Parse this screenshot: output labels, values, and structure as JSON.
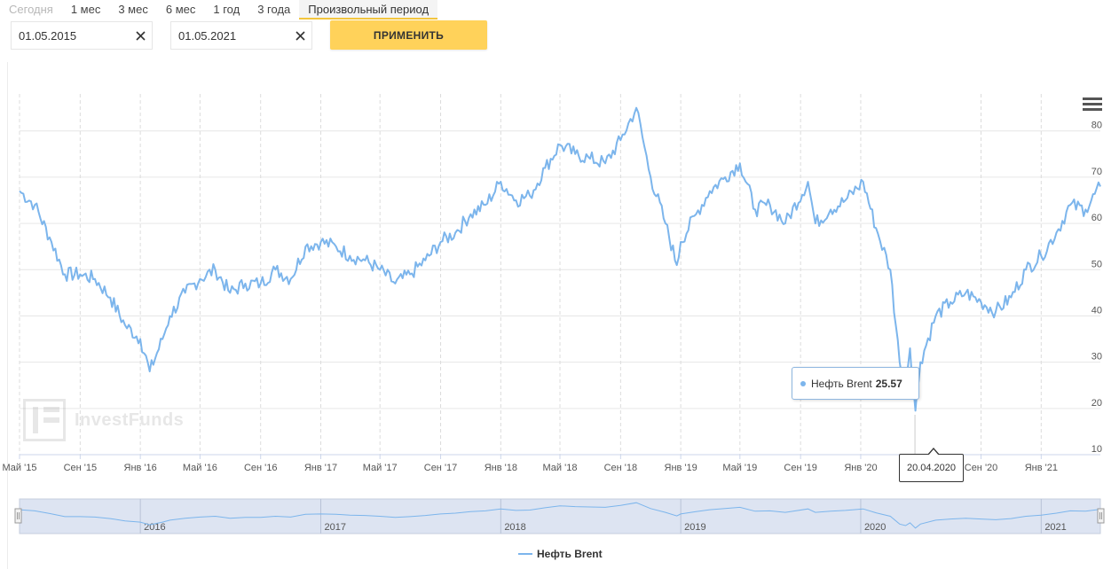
{
  "period_tabs": [
    {
      "label": "Сегодня",
      "state": "disabled"
    },
    {
      "label": "1 мес",
      "state": "normal"
    },
    {
      "label": "3 мес",
      "state": "normal"
    },
    {
      "label": "6 мес",
      "state": "normal"
    },
    {
      "label": "1 год",
      "state": "normal"
    },
    {
      "label": "3 года",
      "state": "normal"
    },
    {
      "label": "Произвольный период",
      "state": "active"
    }
  ],
  "date_from": "01.05.2015",
  "date_to": "01.05.2021",
  "apply_label": "ПРИМЕНИТЬ",
  "watermark": "InvestFunds",
  "tooltip": {
    "series": "Нефть Brent",
    "value": "25.57",
    "date": "20.04.2020"
  },
  "colors": {
    "line": "#7cb5ec",
    "apply": "#ffd25a",
    "navigator_fill": "#dde4f2"
  },
  "icons": {
    "menu": "hamburger-menu-icon",
    "clear": "close-icon"
  },
  "chart_data": {
    "type": "line",
    "series": [
      {
        "name": "Нефть Brent",
        "x": [
          "2015-05-01",
          "2015-06-01",
          "2015-07-01",
          "2015-08-01",
          "2015-09-01",
          "2015-10-01",
          "2015-11-01",
          "2015-12-01",
          "2016-01-01",
          "2016-01-20",
          "2016-02-15",
          "2016-03-01",
          "2016-04-01",
          "2016-05-01",
          "2016-06-01",
          "2016-07-01",
          "2016-08-01",
          "2016-09-01",
          "2016-10-01",
          "2016-11-01",
          "2016-12-01",
          "2017-01-01",
          "2017-02-01",
          "2017-03-01",
          "2017-04-01",
          "2017-05-01",
          "2017-06-01",
          "2017-07-01",
          "2017-08-01",
          "2017-09-01",
          "2017-10-01",
          "2017-11-01",
          "2017-12-01",
          "2018-01-01",
          "2018-02-01",
          "2018-03-01",
          "2018-04-01",
          "2018-05-01",
          "2018-06-01",
          "2018-07-01",
          "2018-08-01",
          "2018-09-01",
          "2018-10-03",
          "2018-11-01",
          "2018-12-01",
          "2018-12-24",
          "2019-01-01",
          "2019-02-01",
          "2019-03-01",
          "2019-04-01",
          "2019-05-01",
          "2019-06-01",
          "2019-07-01",
          "2019-08-01",
          "2019-09-16",
          "2019-10-01",
          "2019-11-01",
          "2019-12-01",
          "2020-01-06",
          "2020-02-01",
          "2020-03-01",
          "2020-03-20",
          "2020-04-01",
          "2020-04-10",
          "2020-04-21",
          "2020-05-01",
          "2020-06-01",
          "2020-07-01",
          "2020-08-01",
          "2020-09-01",
          "2020-10-01",
          "2020-11-01",
          "2020-12-01",
          "2021-01-01",
          "2021-02-01",
          "2021-03-01",
          "2021-04-01",
          "2021-05-01"
        ],
        "values": [
          67,
          64,
          57,
          49,
          49,
          48,
          44,
          38,
          35,
          28,
          35,
          40,
          45,
          48,
          50,
          45,
          47,
          47,
          50,
          48,
          55,
          56,
          55,
          53,
          52,
          50,
          47,
          49,
          52,
          56,
          58,
          62,
          64,
          69,
          65,
          66,
          72,
          77,
          75,
          74,
          73,
          78,
          85,
          70,
          60,
          51,
          56,
          62,
          67,
          70,
          73,
          63,
          64,
          60,
          69,
          60,
          63,
          65,
          69,
          59,
          50,
          30,
          26,
          33,
          19.5,
          30,
          40,
          43,
          45,
          43,
          41,
          44,
          50,
          53,
          58,
          64,
          63,
          68
        ]
      }
    ],
    "y_ticks": [
      "10",
      "20",
      "30",
      "40",
      "50",
      "60",
      "70",
      "80"
    ],
    "ylim": [
      10,
      88
    ],
    "x_ticks": [
      {
        "date": "2015-05-01",
        "label": "Май '15"
      },
      {
        "date": "2015-09-01",
        "label": "Сен '15"
      },
      {
        "date": "2016-01-01",
        "label": "Янв '16"
      },
      {
        "date": "2016-05-01",
        "label": "Май '16"
      },
      {
        "date": "2016-09-01",
        "label": "Сен '16"
      },
      {
        "date": "2017-01-01",
        "label": "Янв '17"
      },
      {
        "date": "2017-05-01",
        "label": "Май '17"
      },
      {
        "date": "2017-09-01",
        "label": "Сен '17"
      },
      {
        "date": "2018-01-01",
        "label": "Янв '18"
      },
      {
        "date": "2018-05-01",
        "label": "Май '18"
      },
      {
        "date": "2018-09-01",
        "label": "Сен '18"
      },
      {
        "date": "2019-01-01",
        "label": "Янв '19"
      },
      {
        "date": "2019-05-01",
        "label": "Май '19"
      },
      {
        "date": "2019-09-01",
        "label": "Сен '19"
      },
      {
        "date": "2020-01-01",
        "label": "Янв '20"
      },
      {
        "date": "2020-09-01",
        "label": "Сен '20"
      },
      {
        "date": "2021-01-01",
        "label": "Янв '21"
      }
    ],
    "navigator_years": [
      {
        "date": "2016-01-01",
        "label": "2016"
      },
      {
        "date": "2017-01-01",
        "label": "2017"
      },
      {
        "date": "2018-01-01",
        "label": "2018"
      },
      {
        "date": "2019-01-01",
        "label": "2019"
      },
      {
        "date": "2020-01-01",
        "label": "2020"
      },
      {
        "date": "2021-01-01",
        "label": "2021"
      }
    ],
    "grid": true,
    "legend_position": "bottom-center"
  }
}
